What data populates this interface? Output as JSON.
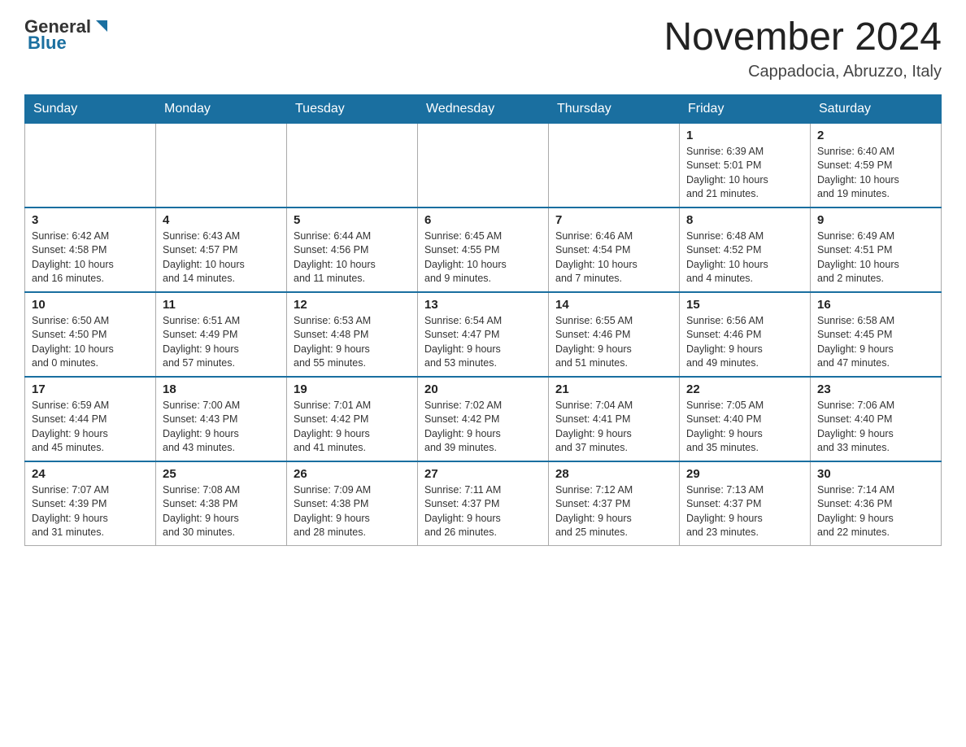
{
  "header": {
    "logo_general": "General",
    "logo_blue": "Blue",
    "month_title": "November 2024",
    "location": "Cappadocia, Abruzzo, Italy"
  },
  "weekdays": [
    "Sunday",
    "Monday",
    "Tuesday",
    "Wednesday",
    "Thursday",
    "Friday",
    "Saturday"
  ],
  "weeks": [
    [
      {
        "day": "",
        "info": ""
      },
      {
        "day": "",
        "info": ""
      },
      {
        "day": "",
        "info": ""
      },
      {
        "day": "",
        "info": ""
      },
      {
        "day": "",
        "info": ""
      },
      {
        "day": "1",
        "info": "Sunrise: 6:39 AM\nSunset: 5:01 PM\nDaylight: 10 hours\nand 21 minutes."
      },
      {
        "day": "2",
        "info": "Sunrise: 6:40 AM\nSunset: 4:59 PM\nDaylight: 10 hours\nand 19 minutes."
      }
    ],
    [
      {
        "day": "3",
        "info": "Sunrise: 6:42 AM\nSunset: 4:58 PM\nDaylight: 10 hours\nand 16 minutes."
      },
      {
        "day": "4",
        "info": "Sunrise: 6:43 AM\nSunset: 4:57 PM\nDaylight: 10 hours\nand 14 minutes."
      },
      {
        "day": "5",
        "info": "Sunrise: 6:44 AM\nSunset: 4:56 PM\nDaylight: 10 hours\nand 11 minutes."
      },
      {
        "day": "6",
        "info": "Sunrise: 6:45 AM\nSunset: 4:55 PM\nDaylight: 10 hours\nand 9 minutes."
      },
      {
        "day": "7",
        "info": "Sunrise: 6:46 AM\nSunset: 4:54 PM\nDaylight: 10 hours\nand 7 minutes."
      },
      {
        "day": "8",
        "info": "Sunrise: 6:48 AM\nSunset: 4:52 PM\nDaylight: 10 hours\nand 4 minutes."
      },
      {
        "day": "9",
        "info": "Sunrise: 6:49 AM\nSunset: 4:51 PM\nDaylight: 10 hours\nand 2 minutes."
      }
    ],
    [
      {
        "day": "10",
        "info": "Sunrise: 6:50 AM\nSunset: 4:50 PM\nDaylight: 10 hours\nand 0 minutes."
      },
      {
        "day": "11",
        "info": "Sunrise: 6:51 AM\nSunset: 4:49 PM\nDaylight: 9 hours\nand 57 minutes."
      },
      {
        "day": "12",
        "info": "Sunrise: 6:53 AM\nSunset: 4:48 PM\nDaylight: 9 hours\nand 55 minutes."
      },
      {
        "day": "13",
        "info": "Sunrise: 6:54 AM\nSunset: 4:47 PM\nDaylight: 9 hours\nand 53 minutes."
      },
      {
        "day": "14",
        "info": "Sunrise: 6:55 AM\nSunset: 4:46 PM\nDaylight: 9 hours\nand 51 minutes."
      },
      {
        "day": "15",
        "info": "Sunrise: 6:56 AM\nSunset: 4:46 PM\nDaylight: 9 hours\nand 49 minutes."
      },
      {
        "day": "16",
        "info": "Sunrise: 6:58 AM\nSunset: 4:45 PM\nDaylight: 9 hours\nand 47 minutes."
      }
    ],
    [
      {
        "day": "17",
        "info": "Sunrise: 6:59 AM\nSunset: 4:44 PM\nDaylight: 9 hours\nand 45 minutes."
      },
      {
        "day": "18",
        "info": "Sunrise: 7:00 AM\nSunset: 4:43 PM\nDaylight: 9 hours\nand 43 minutes."
      },
      {
        "day": "19",
        "info": "Sunrise: 7:01 AM\nSunset: 4:42 PM\nDaylight: 9 hours\nand 41 minutes."
      },
      {
        "day": "20",
        "info": "Sunrise: 7:02 AM\nSunset: 4:42 PM\nDaylight: 9 hours\nand 39 minutes."
      },
      {
        "day": "21",
        "info": "Sunrise: 7:04 AM\nSunset: 4:41 PM\nDaylight: 9 hours\nand 37 minutes."
      },
      {
        "day": "22",
        "info": "Sunrise: 7:05 AM\nSunset: 4:40 PM\nDaylight: 9 hours\nand 35 minutes."
      },
      {
        "day": "23",
        "info": "Sunrise: 7:06 AM\nSunset: 4:40 PM\nDaylight: 9 hours\nand 33 minutes."
      }
    ],
    [
      {
        "day": "24",
        "info": "Sunrise: 7:07 AM\nSunset: 4:39 PM\nDaylight: 9 hours\nand 31 minutes."
      },
      {
        "day": "25",
        "info": "Sunrise: 7:08 AM\nSunset: 4:38 PM\nDaylight: 9 hours\nand 30 minutes."
      },
      {
        "day": "26",
        "info": "Sunrise: 7:09 AM\nSunset: 4:38 PM\nDaylight: 9 hours\nand 28 minutes."
      },
      {
        "day": "27",
        "info": "Sunrise: 7:11 AM\nSunset: 4:37 PM\nDaylight: 9 hours\nand 26 minutes."
      },
      {
        "day": "28",
        "info": "Sunrise: 7:12 AM\nSunset: 4:37 PM\nDaylight: 9 hours\nand 25 minutes."
      },
      {
        "day": "29",
        "info": "Sunrise: 7:13 AM\nSunset: 4:37 PM\nDaylight: 9 hours\nand 23 minutes."
      },
      {
        "day": "30",
        "info": "Sunrise: 7:14 AM\nSunset: 4:36 PM\nDaylight: 9 hours\nand 22 minutes."
      }
    ]
  ]
}
